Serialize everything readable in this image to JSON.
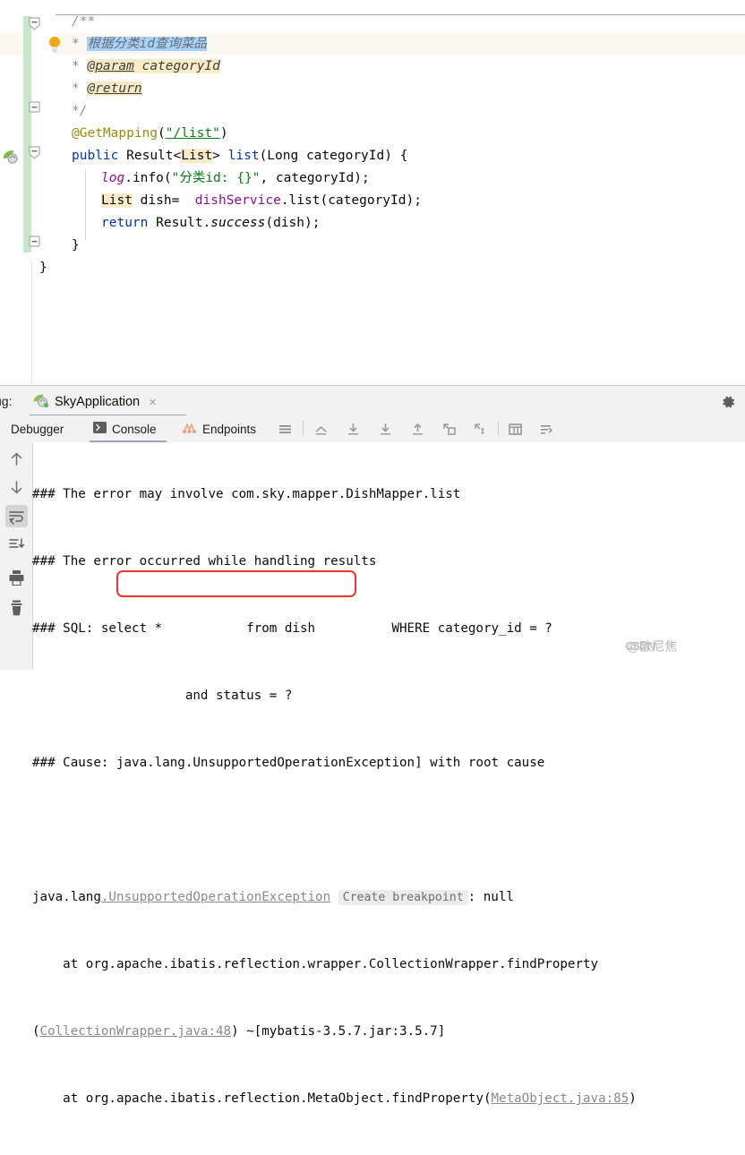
{
  "editor": {
    "language": "java",
    "lines": [
      {
        "n": 1,
        "text": "/**"
      },
      {
        "n": 2,
        "text": " * 根据分类id查询菜品",
        "selected_text": "根据分类id查询菜品",
        "has_bulb": true
      },
      {
        "n": 3,
        "text": " * @param categoryId",
        "tag": "@param",
        "param": "categoryId"
      },
      {
        "n": 4,
        "text": " * @return",
        "tag": "@return"
      },
      {
        "n": 5,
        "text": " */"
      },
      {
        "n": 6,
        "text": "@GetMapping(\"/list\")",
        "annotation": "@GetMapping",
        "string": "\"/list\""
      },
      {
        "n": 7,
        "text": "public Result<List> list(Long categoryId) {"
      },
      {
        "n": 8,
        "text": "    log.info(\"分类id: {}\", categoryId);"
      },
      {
        "n": 9,
        "text": "    List dish=  dishService.list(categoryId);"
      },
      {
        "n": 10,
        "text": "    return Result.success(dish);"
      },
      {
        "n": 11,
        "text": "}"
      },
      {
        "n": 12,
        "text": "}"
      }
    ],
    "tokens": {
      "comment_open": "/**",
      "comment_star": "*",
      "doc_text": "根据分类id查询菜品",
      "doc_param_tag": "@param",
      "doc_param_name": "categoryId",
      "doc_return_tag": "@return",
      "comment_close": "*/",
      "mapping_annotation": "@GetMapping",
      "mapping_path": "\"/list\"",
      "kw_public": "public",
      "type_result": "Result",
      "type_list": "List",
      "method_list": "list",
      "type_long": "Long",
      "arg_categoryid": "categoryId",
      "logger": "log",
      "log_method": "info",
      "log_format": "\"分类id: {}\"",
      "var_dish": "dish",
      "service": "dishService",
      "kw_return": "return",
      "result_success": "success",
      "brace_open": "{",
      "brace_close": "}"
    },
    "colors": {
      "keyword": "#0033b3",
      "string": "#067d17",
      "annotation": "#9e880d",
      "field": "#871094",
      "comment": "#8c8c8c",
      "selection": "#a6d2ff",
      "identifier_highlight": "#fbecc8",
      "caret_line": "#faf8ef",
      "vcs_added": "#c8e6c9"
    },
    "gutter_icons": [
      "fold-collapse-icon",
      "intention-bulb-icon",
      "fold-collapse-icon",
      "spring-bean-icon"
    ]
  },
  "debug_window": {
    "label": "ug:",
    "full_label": "Debug:",
    "run_tab": {
      "title": "SkyApplication",
      "icon": "spring-boot-icon",
      "close": "×",
      "running": true
    },
    "settings_icon": "gear-icon",
    "tabs": [
      {
        "id": "debugger",
        "label": "Debugger",
        "icon": null,
        "active": false
      },
      {
        "id": "console",
        "label": "Console",
        "icon": "console-icon",
        "active": true
      },
      {
        "id": "endpoints",
        "label": "Endpoints",
        "icon": "endpoints-icon",
        "active": false
      }
    ],
    "toolbar_buttons": [
      "menu-icon",
      "step-out-icon",
      "step-over-icon",
      "step-into-icon",
      "force-step-into-icon",
      "run-to-cursor-icon",
      "evaluate-icon",
      "table-icon",
      "filter-icon"
    ],
    "side_buttons": [
      "scroll-up-icon",
      "scroll-down-icon",
      "soft-wrap-icon",
      "scroll-to-end-icon",
      "print-icon",
      "clear-all-icon"
    ],
    "side_active": "soft-wrap-icon"
  },
  "console": {
    "lines": [
      {
        "id": "l1",
        "text": "### The error may involve com.sky.mapper.DishMapper.list"
      },
      {
        "id": "l2",
        "text": "### The error occurred while handling results"
      },
      {
        "id": "l3",
        "text": "### SQL: select *           from dish          WHERE category_id = ?"
      },
      {
        "id": "l4",
        "text": "                    and status = ?"
      },
      {
        "id": "l5",
        "text": "### Cause: java.lang.UnsupportedOperationException] with root cause"
      },
      {
        "id": "l6",
        "text": ""
      },
      {
        "id": "l7_prefix",
        "text": "java.lang"
      },
      {
        "id": "l7_exception",
        "text": ".UnsupportedOperationException"
      },
      {
        "id": "l7_chip",
        "text": "Create breakpoint"
      },
      {
        "id": "l7_suffix",
        "text": ": null"
      },
      {
        "id": "l8",
        "text": "    at org.apache.ibatis.reflection.wrapper.CollectionWrapper.findProperty"
      },
      {
        "id": "l9_a",
        "text": "("
      },
      {
        "id": "l9_link",
        "text": "CollectionWrapper.java:48"
      },
      {
        "id": "l9_b",
        "text": ") ~[mybatis-3.5.7.jar:3.5.7]"
      },
      {
        "id": "l10_a",
        "text": "    at org.apache.ibatis.reflection.MetaObject.findProperty("
      },
      {
        "id": "l10_link",
        "text": "MetaObject.java:85"
      },
      {
        "id": "l10_b",
        "text": ")"
      }
    ],
    "annotation_box": {
      "name": "red-highlight-box",
      "color": "#f0342a"
    }
  },
  "watermark": {
    "brand": "CSDN",
    "author": "@欧尼焦"
  }
}
